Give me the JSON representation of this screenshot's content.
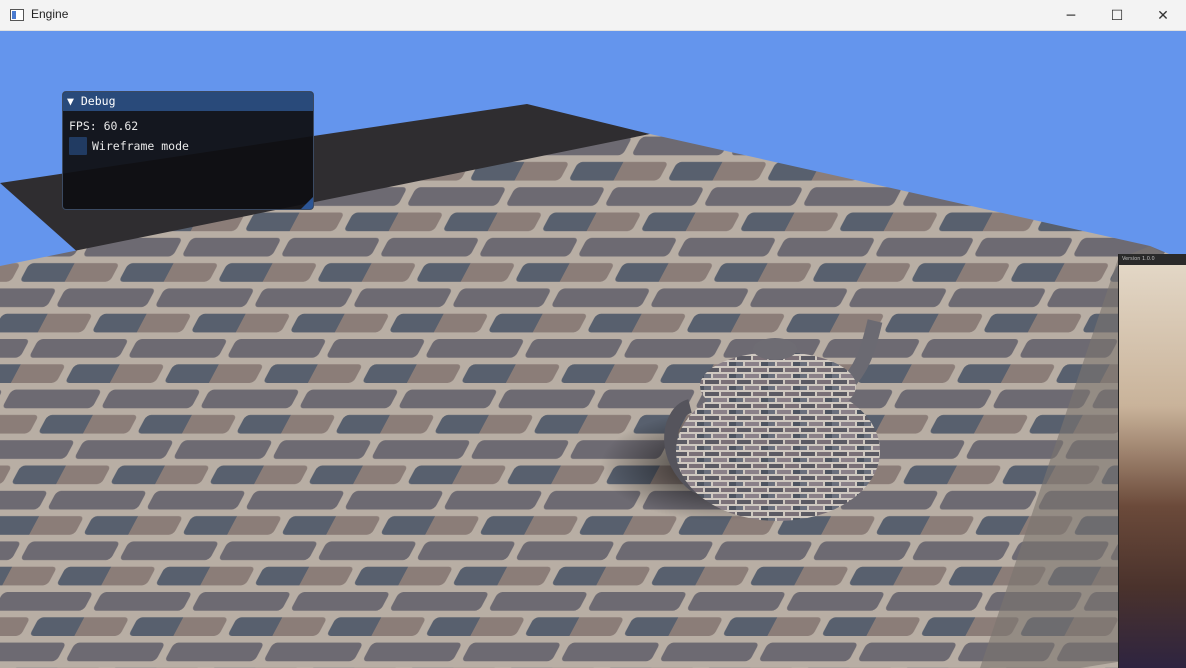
{
  "window": {
    "title": "Engine",
    "minimize_glyph": "─",
    "maximize_glyph": "☐",
    "close_glyph": "✕"
  },
  "scene": {
    "clear_color": "#6495ed",
    "floor": "stone brick textured plane",
    "object": "stone brick textured teapot"
  },
  "debug_panel": {
    "collapse_glyph": "▼",
    "title": "Debug",
    "fps_text": "FPS: 60.62",
    "wireframe_label": "Wireframe mode",
    "wireframe_checked": false
  },
  "overlay_window": {
    "title": "Version 1.0.0"
  }
}
